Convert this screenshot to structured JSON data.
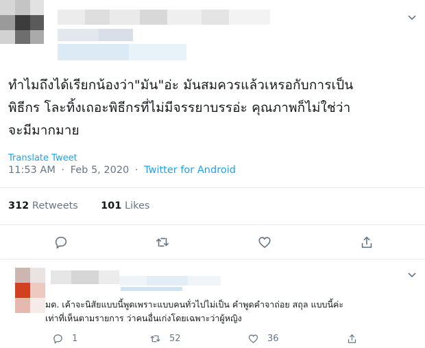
{
  "tweet": {
    "text_line1": "ทำไมถึงได้เรียกน้องว่า\"มัน\"อ่ะ มันสมควรแล้วเหรอกับการเป็น",
    "text_line2": "พิธีกร โละทิ้งเถอะพิธีกรที่ไม่มีจรรยาบรรอ่ะ คุณภาพก็ไม่ใช่ว่า",
    "text_line3": "จะมีมากมาย",
    "translate_label": "Translate Tweet",
    "time": "11:53 AM",
    "date": "Feb 5, 2020",
    "dot": "·",
    "source": "Twitter for Android",
    "retweets_count": "312",
    "retweets_label": "Retweets",
    "likes_count": "101",
    "likes_label": "Likes"
  },
  "reply": {
    "text_line1": "มด.  เค้าจะนิสัยแบบนี้พูดเพราะแบบคนทั่วไปไม่เป็น คำพูดคำจาถ่อย สถุล แบบนี้ค่ะ",
    "text_line2": "เท่าที่เห็นตามรายการ ว่าคนอื่นเก่งโดยเฉพาะว่าผู้หญิง",
    "replies": "1",
    "retweets": "52",
    "likes": "36"
  },
  "colors": {
    "accent": "#1da1f2",
    "muted": "#657786",
    "text": "#14171a",
    "border": "#e6ecf0"
  },
  "icons": [
    "chevron-down-icon",
    "reply-icon",
    "retweet-icon",
    "like-icon",
    "share-icon"
  ]
}
